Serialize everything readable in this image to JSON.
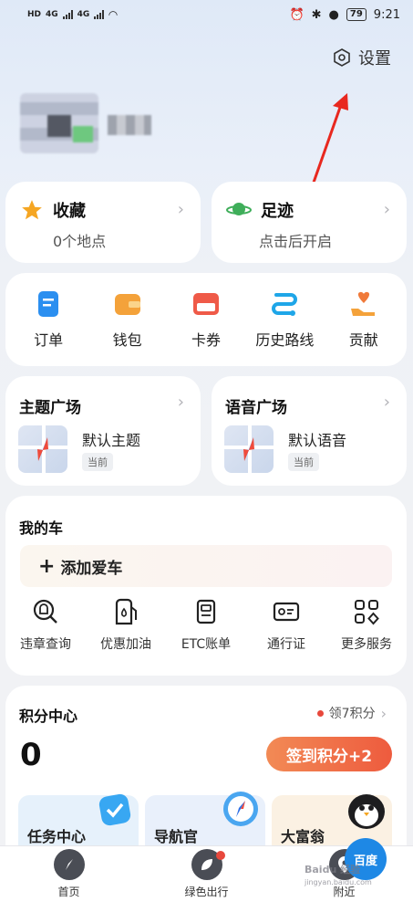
{
  "status_bar": {
    "left_icons": [
      "HD",
      "4G",
      "4G",
      "wifi"
    ],
    "sim1": "HD",
    "sim2": "HD",
    "net1": "4G",
    "net2": "4G",
    "battery": "79",
    "time": "9:21"
  },
  "header": {
    "settings_label": "设置"
  },
  "favorites": {
    "title": "收藏",
    "subtitle": "0个地点"
  },
  "footprint": {
    "title": "足迹",
    "subtitle": "点击后开启"
  },
  "tools": [
    {
      "label": "订单",
      "icon": "order-icon",
      "color": "#2b8ff0"
    },
    {
      "label": "钱包",
      "icon": "wallet-icon",
      "color": "#f4a23a"
    },
    {
      "label": "卡券",
      "icon": "coupon-icon",
      "color": "#ef5a48"
    },
    {
      "label": "历史路线",
      "icon": "route-history-icon",
      "color": "#1fa6e8"
    },
    {
      "label": "贡献",
      "icon": "contribution-icon",
      "color": "#f07a3a"
    }
  ],
  "theme": {
    "title": "主题广场",
    "option": "默认主题",
    "badge": "当前"
  },
  "voice": {
    "title": "语音广场",
    "option": "默认语音",
    "badge": "当前"
  },
  "car": {
    "title": "我的车",
    "add_label": "添加爱车",
    "services": [
      {
        "label": "违章查询",
        "icon": "violation-query-icon"
      },
      {
        "label": "优惠加油",
        "icon": "fuel-icon"
      },
      {
        "label": "ETC账单",
        "icon": "etc-bill-icon"
      },
      {
        "label": "通行证",
        "icon": "pass-card-icon"
      },
      {
        "label": "更多服务",
        "icon": "more-services-icon"
      }
    ]
  },
  "points": {
    "title": "积分中心",
    "reward_text": "领7积分",
    "value": "0",
    "signin_label": "签到积分+2",
    "tasks": [
      {
        "label": "任务中心",
        "bg": "#e6f1fb"
      },
      {
        "label": "导航官",
        "bg": "#e9f0fb"
      },
      {
        "label": "大富翁",
        "bg": "#fbf1e3"
      }
    ]
  },
  "bottom_nav": [
    {
      "label": "首页",
      "icon": "compass-icon"
    },
    {
      "label": "绿色出行",
      "icon": "leaf-icon"
    },
    {
      "label": "附近",
      "icon": "location-pin-icon"
    }
  ],
  "watermark": {
    "brand": "Baidu 经验",
    "sub": "jingyan.baidu.com",
    "badge": "百度"
  },
  "colors": {
    "accent": "#ee5b3e",
    "link_blue": "#2b8ff0",
    "arrow_red": "#e8281f"
  }
}
